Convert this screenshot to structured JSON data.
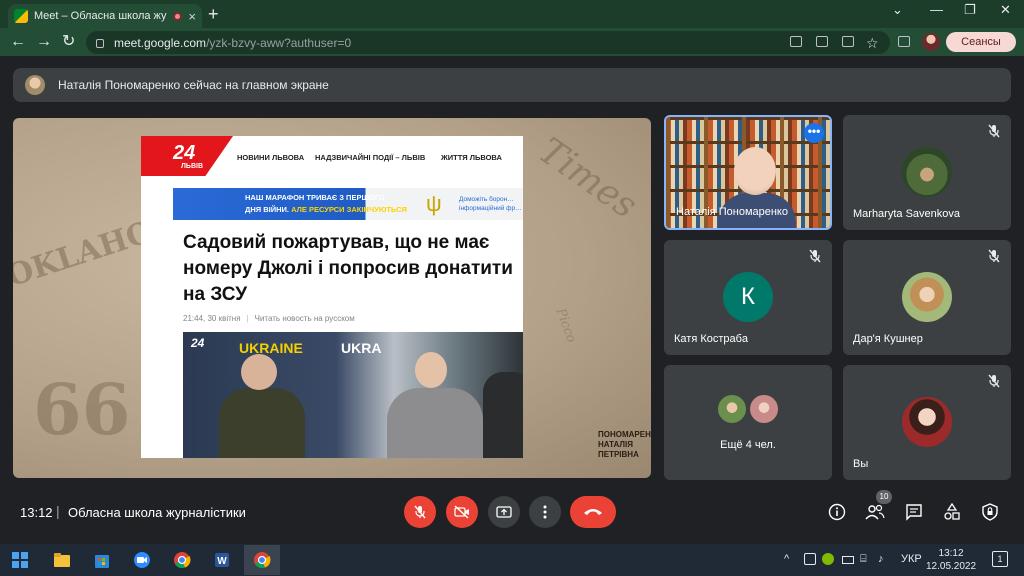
{
  "browser": {
    "tab_title": "Meet – Обласна школа жур…",
    "tab_close": "×",
    "new_tab": "+",
    "url_host": "meet.google.com",
    "url_path": "/yzk-bzvy-aww?authuser=0",
    "incognito_label": "Сеансы",
    "window_controls": [
      "⌄",
      "—",
      "❐",
      "✕"
    ]
  },
  "banner": {
    "text": "Наталія Пономаренко сейчас на главном экране"
  },
  "presentation": {
    "logo_number": "24",
    "logo_city": "ЛЬВІВ",
    "nav": [
      "НОВИНИ ЛЬВОВА",
      "НАДЗВИЧАЙНІ ПОДІЇ – ЛЬВІВ",
      "ЖИТТЯ ЛЬВОВА"
    ],
    "ad_line1": "НАШ МАРАФОН ТРИВАЄ З ПЕРШОГО",
    "ad_line2a": "ДНЯ ВІЙНИ.",
    "ad_line2b": "АЛЕ РЕСУРСИ ЗАКІНЧУЮТЬСЯ",
    "ad_side": "Доможіть борон…\nінформаційний фр…",
    "headline": "Садовий пожартував, що не має номеру Джолі і попросив донатити на ЗСУ",
    "time": "21:44, 30 квітня",
    "read_ru": "Читать новость на русском",
    "photo_text1": "UKRAINE",
    "photo_text2": "UKRA",
    "photo_logo": "24",
    "signature_line1": "ПОНОМАРЕНКО",
    "signature_line2": "НАТАЛІЯ",
    "signature_line3": "ПЕТРІВНА",
    "bg_text1": "OKLAHOMA",
    "bg_text2": "66",
    "bg_text3": "Times",
    "bg_text4": "Picco"
  },
  "participants": [
    {
      "name": "Наталія Пономаренко",
      "muted": false,
      "active": true
    },
    {
      "name": "Marharyta Savenkova",
      "muted": true
    },
    {
      "name": "Катя Кострабa",
      "muted": true,
      "initial": "К"
    },
    {
      "name": "Дар'я Кушнер",
      "muted": true
    },
    {
      "name": "Ещё 4 чел.",
      "muted": false
    },
    {
      "name": "Вы",
      "muted": true
    }
  ],
  "more_button": "•••",
  "bottom_bar": {
    "time": "13:12",
    "divider": "|",
    "meeting_name": "Обласна школа журналістики",
    "participant_count": "10"
  },
  "taskbar": {
    "time": "13:12",
    "date": "12.05.2022",
    "lang": "УКР",
    "notif_count": "1"
  },
  "colors": {
    "tab_bg": "#1c3d2a",
    "toolbar_bg": "#244d35",
    "meet_bg": "#202124",
    "tile_bg": "#3c4043",
    "red": "#ea4335",
    "active_border": "#8ab4f8"
  }
}
